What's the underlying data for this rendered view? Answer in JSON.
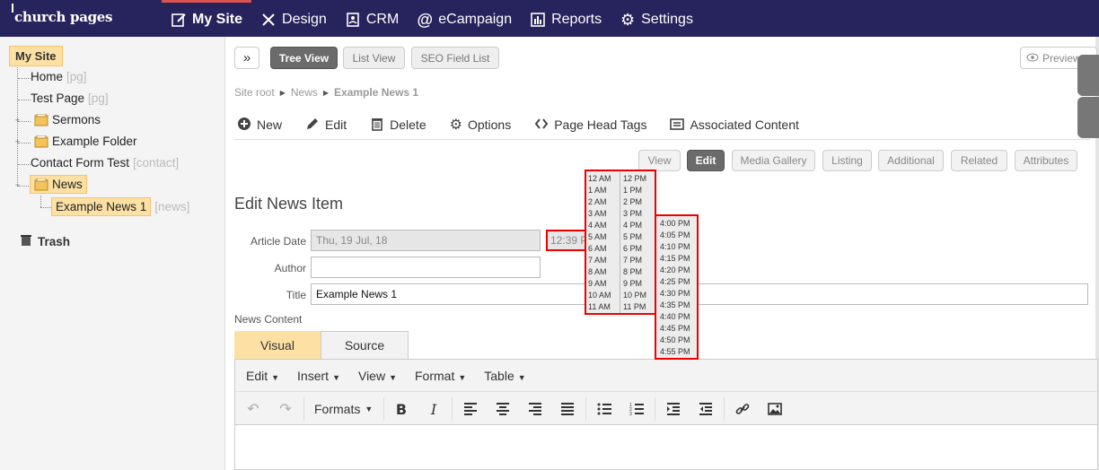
{
  "brand": {
    "logo_text": "church pages"
  },
  "nav": [
    {
      "label": "My Site",
      "icon": "edit-icon",
      "active": true
    },
    {
      "label": "Design",
      "icon": "tools-icon"
    },
    {
      "label": "CRM",
      "icon": "contacts-icon"
    },
    {
      "label": "eCampaign",
      "icon": "at-icon"
    },
    {
      "label": "Reports",
      "icon": "bar-chart-icon"
    },
    {
      "label": "Settings",
      "icon": "gear-icon"
    }
  ],
  "sidebar": {
    "root": "My Site",
    "items": [
      {
        "label": "Home",
        "tag": "[pg]"
      },
      {
        "label": "Test Page",
        "tag": "[pg]"
      },
      {
        "label": "Sermons",
        "tag": ""
      },
      {
        "label": "Example Folder",
        "tag": ""
      },
      {
        "label": "Contact Form Test",
        "tag": "[contact]"
      },
      {
        "label": "News",
        "tag": ""
      },
      {
        "label": "Example News 1",
        "tag": "[news]"
      }
    ],
    "trash": "Trash"
  },
  "view_buttons": {
    "expand": "»",
    "tree": "Tree View",
    "list": "List View",
    "seo": "SEO Field List",
    "preview": "Preview"
  },
  "breadcrumb": {
    "root": "Site root",
    "parent": "News",
    "current": "Example News 1"
  },
  "toolbar": {
    "new": "New",
    "edit": "Edit",
    "delete": "Delete",
    "options": "Options",
    "head_tags": "Page Head Tags",
    "associated": "Associated Content"
  },
  "tabs": [
    "View",
    "Edit",
    "Media Gallery",
    "Listing",
    "Additional",
    "Related",
    "Attributes"
  ],
  "form": {
    "title": "Edit News Item",
    "article_date_label": "Article Date",
    "article_date_value": "Thu, 19 Jul, 18",
    "time_value": "12:39 P",
    "author_label": "Author",
    "author_value": "",
    "title_label": "Title",
    "title_value": "Example News 1",
    "content_label": "News Content"
  },
  "editor": {
    "mode_tabs": [
      "Visual",
      "Source"
    ],
    "menus": [
      "Edit",
      "Insert",
      "View",
      "Format",
      "Table"
    ],
    "formats": "Formats"
  },
  "hour_picker": {
    "am": [
      "12 AM",
      "1 AM",
      "2 AM",
      "3 AM",
      "4 AM",
      "5 AM",
      "6 AM",
      "7 AM",
      "8 AM",
      "9 AM",
      "10 AM",
      "11 AM"
    ],
    "pm": [
      "12 PM",
      "1 PM",
      "2 PM",
      "3 PM",
      "4 PM",
      "5 PM",
      "6 PM",
      "7 PM",
      "8 PM",
      "9 PM",
      "10 PM",
      "11 PM"
    ]
  },
  "minute_picker": [
    "4:00 PM",
    "4:05 PM",
    "4:10 PM",
    "4:15 PM",
    "4:20 PM",
    "4:25 PM",
    "4:30 PM",
    "4:35 PM",
    "4:40 PM",
    "4:45 PM",
    "4:50 PM",
    "4:55 PM"
  ],
  "colors": {
    "nav_bg": "#27235c",
    "active_accent": "#d9534f",
    "highlight": "#fde1a4",
    "callout": "#e00000"
  }
}
